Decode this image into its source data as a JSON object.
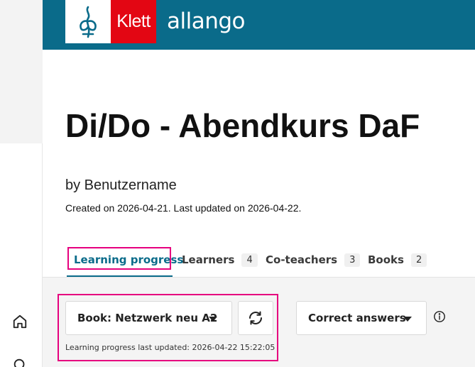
{
  "brand": {
    "publisher": "Klett",
    "product": "allango",
    "colors": {
      "header": "#0a6b8a",
      "publisher_red": "#e30613",
      "highlight": "#e6007e"
    }
  },
  "rail": {
    "icons": [
      "home-icon",
      "search-icon"
    ]
  },
  "course": {
    "title": "Di/Do - Abendkurs DaF",
    "byline": "by Benutzername",
    "meta": "Created on 2026-04-21. Last updated on 2026-04-22."
  },
  "tabs": [
    {
      "label": "Learning progress",
      "count": null,
      "active": true
    },
    {
      "label": "Learners",
      "count": "4"
    },
    {
      "label": "Co-teachers",
      "count": "3"
    },
    {
      "label": "Books",
      "count": "2"
    }
  ],
  "controls": {
    "book_select": "Book: Netzwerk neu A2",
    "refresh_icon": "refresh-icon",
    "last_updated": "Learning progress last updated: 2026-04-22 15:22:05",
    "metric_select": "Correct answers",
    "info_icon": "info-icon"
  }
}
